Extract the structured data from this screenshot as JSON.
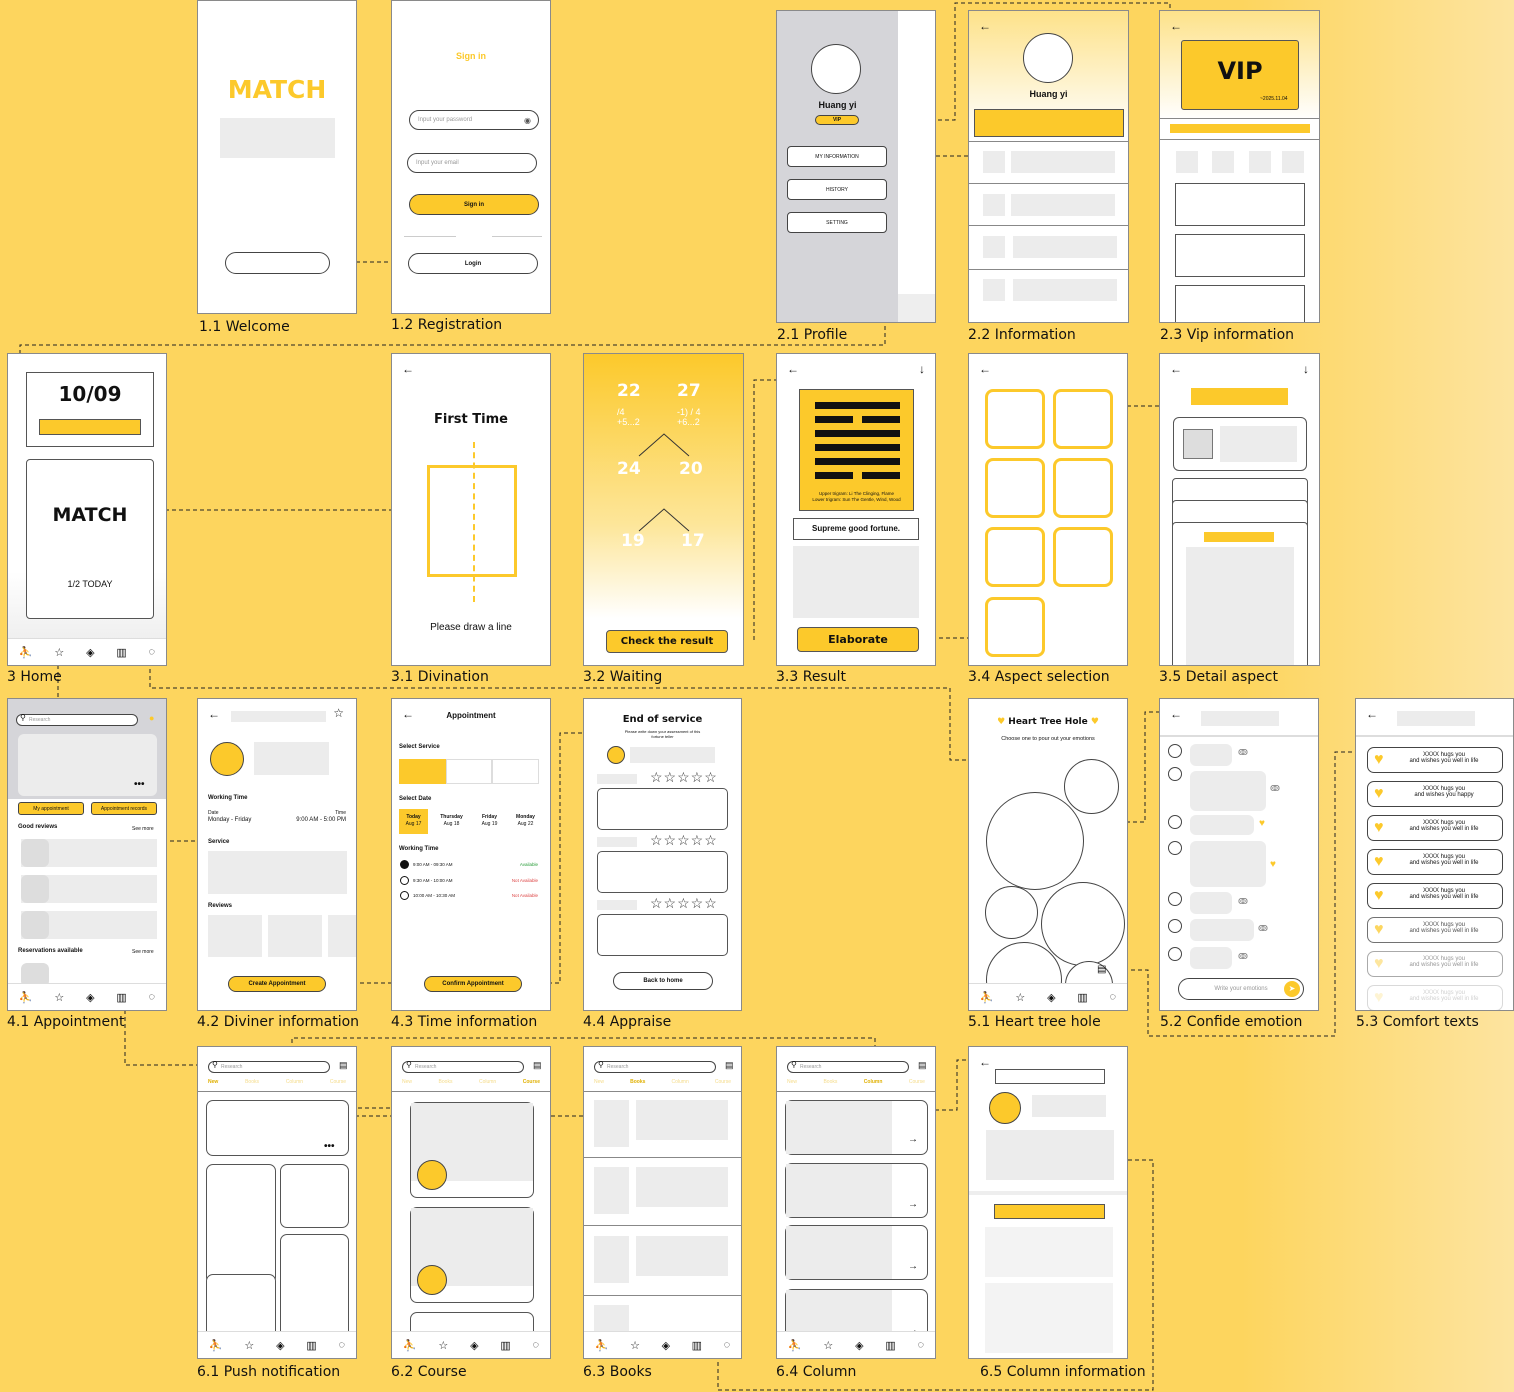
{
  "captions": {
    "welcome": "1.1 Welcome",
    "registration": "1.2 Registration",
    "profile": "2.1 Profile",
    "information": "2.2 Information",
    "vip_information": "2.3 Vip information",
    "home": "3 Home",
    "divination": "3.1 Divination",
    "waiting": "3.2 Waiting",
    "result": "3.3 Result",
    "aspect_selection": "3.4 Aspect selection",
    "detail_aspect": "3.5 Detail aspect",
    "appointment": "4.1 Appointment",
    "diviner_information": "4.2 Diviner information",
    "time_information": "4.3 Time information",
    "appraise": "4.4 Appraise",
    "heart_tree_hole": "5.1 Heart tree hole",
    "confide_emotion": "5.2 Confide emotion",
    "comfort_texts": "5.3 Comfort texts",
    "push_notification": "6.1 Push notification",
    "course": "6.2 Course",
    "books": "6.3 Books",
    "column": "6.4 Column",
    "column_information": "6.5 Column information"
  },
  "welcome": {
    "logo": "MATCH"
  },
  "registration": {
    "title": "Sign in",
    "password_placeholder": "Input your password",
    "email_placeholder": "Input your email",
    "sign_in": "Sign in",
    "login": "Login"
  },
  "profile": {
    "name": "Huang yi",
    "badge": "VIP",
    "menu": [
      "MY INFORMATION",
      "HISTORY",
      "SETTING"
    ]
  },
  "information": {
    "name": "Huang yi"
  },
  "vip": {
    "title": "VIP",
    "expiry": "~2025.11.04"
  },
  "home": {
    "date": "10/09",
    "logo": "MATCH",
    "today": "1/2 TODAY"
  },
  "divination": {
    "title": "First Time",
    "hint": "Please draw a line"
  },
  "waiting": {
    "numbers": [
      "22",
      "27",
      "24",
      "20",
      "19",
      "17"
    ],
    "sub1": "/4\n+5...2",
    "sub2": "-1) / 4\n+6...2",
    "button": "Check the result"
  },
  "result": {
    "trigram_text": "Upper trigram: Li The Clinging, Flame\nLower trigram: Sun The Gentle, Wind, Wood",
    "fortune": "Supreme good fortune.",
    "button": "Elaborate"
  },
  "appointment": {
    "search": "Research",
    "my_appointment": "My appointment",
    "records": "Appointment records",
    "good_reviews": "Good reviews",
    "see_more": "See more",
    "reservations": "Reservations available"
  },
  "diviner": {
    "working_time": "Working Time",
    "date_label": "Date",
    "time_label": "Time",
    "days": "Monday - Friday",
    "hours": "9:00 AM - 5:00 PM",
    "service": "Service",
    "reviews": "Reviews",
    "button": "Create Appointment"
  },
  "time_info": {
    "title": "Appointment",
    "select_service": "Select Service",
    "select_date": "Select Date",
    "dates": [
      {
        "day": "Today",
        "date": "Aug 17"
      },
      {
        "day": "Thursday",
        "date": "Aug 18"
      },
      {
        "day": "Friday",
        "date": "Aug 19"
      },
      {
        "day": "Monday",
        "date": "Aug 22"
      }
    ],
    "working_time": "Working Time",
    "slots": [
      {
        "time": "9:00 AM - 09:30 AM",
        "status": "Available"
      },
      {
        "time": "9:30 AM - 10:00 AM",
        "status": "Not Available"
      },
      {
        "time": "10:00 AM - 10:30 AM",
        "status": "Not Available"
      }
    ],
    "button": "Confirm Appointment"
  },
  "appraise": {
    "title": "End of service",
    "subtitle": "Please write down your assessment of this fortune teller",
    "stars": "☆☆☆☆☆",
    "button": "Back to home"
  },
  "heart": {
    "title": "Heart Tree Hole",
    "subtitle": "Choose one to pour out your emotions"
  },
  "confide": {
    "placeholder": "Write your emotions"
  },
  "comfort": {
    "items": [
      "XXXX hugs you\nand wishes you well in life",
      "XXXX hugs you\nand wishes you happy",
      "XXXX hugs you\nand wishes you well in life",
      "XXXX hugs you\nand wishes you well in life",
      "XXXX hugs you\nand wishes you well in life",
      "XXXX hugs you\nand wishes you well in life",
      "XXXX hugs you\nand wishes you well in life",
      "XXXX hugs you\nand wishes you well in life"
    ]
  },
  "feed": {
    "search": "Research",
    "tabs": [
      "New",
      "Books",
      "Column",
      "Course"
    ]
  },
  "colors": {
    "background": "#fdd55e",
    "accent": "#fcc92b"
  }
}
